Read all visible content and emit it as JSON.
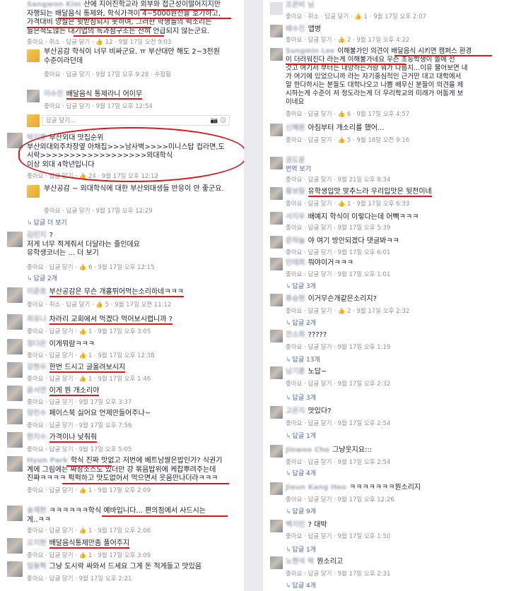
{
  "left": {
    "c1": {
      "l1": "산에 지어진학교라 외부와 접근성이떨어지지만",
      "l2": "자행되는 배달음식 통제와, 학식가격이 4~5000원선을 호가하고,",
      "l3": "가격대비 양질은 뒷받침되지 못하며, 그러한 학생들의 퍽소리는",
      "l4": "들은척도않는 대기업의 독과점구조는 전혀 언급되지 않는군요.",
      "meta": "좋아요 · 취소 · 답글 달기 · 👍 12 · 9월 17일 오전 9:03"
    },
    "c1r1": {
      "text": "부산공감 학식이 너무 비싸군요. ㅠ 부산대만 해도 2~3천원 수준이라던데",
      "meta": "좋아요 · 답글 달기 · 9월 17일 오후 9:28 · 수정됨"
    },
    "c1r2": {
      "text": "배달음식 통제라니 어이무",
      "meta": "좋아요 · 답글 달기 · 9월 17일 오후 12:54"
    },
    "c1input": {
      "placeholder": "답글 달기..."
    },
    "c2": {
      "l0": "부산외대 맛집순위",
      "l1": "부산외대외주차장옆 아채집>>>남사벽>>>>미니스탑 컵라면,도",
      "l2": "시락>>>>>>>>>>>>>>>>>>외대학식",
      "l3": "이상 외대 4학년입니다",
      "meta": "좋아요 · 답글 달기 · 👍 24 · 9월 17일 오후 12:12"
    },
    "c2r1": {
      "text": "부산공감 ~ 외대학식에 대한 부산외대생들 반응이 안 좋군요.",
      "meta": "좋아요 · 답글 달기 · 9월 17일 오후 12:29"
    },
    "c2more": "답글 더 보기",
    "c3": {
      "l1": "?",
      "l2": "저게 너무 적게줘서 더달라는 줄인데요",
      "l3": "유학생코너는 ... 더 보기",
      "meta": "좋아요 · 답글 달기 · 👍 6 · 9월 17일 오후 12:15"
    },
    "c3replies": "답글 2개",
    "items": [
      {
        "text": "부산공감은 무슨 개홀뛰어먹는소리하네ㅋㅋㅋ",
        "meta": "좋아요 · 취소 · 답글 달기 · 👍 5 · 9월 17일 오전 11:12"
      },
      {
        "text": "차라리 교회에서 먹겠다 먹어보시렵니까 ?",
        "meta": "좋아요 · 답글 달기 · 👍 1 · 9월 17일 오후 3:05"
      },
      {
        "text": "이게뭐람ㅋㅋㅋ",
        "meta": "좋아요 · 답글 달기 · 👍 1 · 9월 17일 오후 12:38"
      },
      {
        "text": "한번 드시고 글올려보시지",
        "meta": "좋아요 · 답글 달기 · 👍 1 · 9월 17일 오후 1:46"
      },
      {
        "text": "이게 뭔 개소리야",
        "meta": "좋아요 · 답글 달기 · 9월 17일 오후 3:37"
      },
      {
        "text": "페이스북 싫어요 언제만들어주나~",
        "meta": "좋아요 · 답글 달기 · 9월 17일 오후 7:56"
      },
      {
        "text": "가격이나 낮춰줘",
        "meta": "좋아요 · 답글 달기 · 9월 17일 오후 5:05"
      }
    ],
    "c4": {
      "l1": "학식 진짜 맛없고 저번에 베트남쌀은밥인가? 식권기",
      "l2": "계에 그림에는 짜장소스도 있더만 걍 볶음밥위에 케찹뿌려주는데",
      "l3": "진짜ㅋㅋㅋㅋ 퍽퍽하고 맛도없어서 먹으면서 웃음만나더라ㅋㅋㅋ",
      "meta": "좋아요 · 답글 달기 · 👍 1 · 9월 17일 오후 2:09"
    },
    "c5": {
      "l1": "ㅋㅋㅋㅋㅋㅋ학식 예바입니다... 편의점에서 사드시는",
      "l2": "게..ㅋㅋ",
      "meta": "좋아요 · 답글 달기 · 👍 1 · 9월 17일 오후 2:06"
    },
    "c6": {
      "text": "배달음식통제만좀 풀어주지",
      "meta": "좋아요 · 답글 달기 · 👍 1 · 9월 17일 오후 3:09"
    },
    "c7": {
      "text": "그냥 도시락 싸와서 드세요 그게 돈 적게들고 맛있음",
      "meta": "좋아요 · 답글 달기 · 9월 17일 오후 2:21"
    }
  },
  "right": {
    "r1meta": "좋아요 · 취소 · 답글 달기 · 👍 1 · 9월 17일 오후 2:07",
    "r2": {
      "text": "앱병",
      "meta": "좋아요 · 답글 달기 · 👍 2 · 9월 17일 오후 4:22"
    },
    "r3": {
      "l1": "이해불가인 의견이 배달음식 시키면 캠퍼스 환경",
      "l2": "이 더러워진다 라는게 이해불가네요 무슨 초등학생이 쓸에 선",
      "l3": "것고 여기서 부터는 내망하는거랑 뭐가 다름지...이유 물어보면 내",
      "l4": "가 여기에 있었으니까 라는 자기중심적인 근거만 대고 대학에서",
      "l5": "알 한다하시는 분들도 대학나오고 나쁨 배우신 분들이 의견을 제",
      "l6": "시하는게 수준이 저 정도라는게 더 우리학교의 미래가 어둡게 보",
      "l7": "이네요",
      "meta": "좋아요 · 답글 달기 · 👍 6 · 9월 17일 오후 4:57"
    },
    "r4": {
      "text": "아침부터 개소리를 했어...",
      "meta": "좋아요 · 답글 달기 · 👍 5 · 9월 18일 오전 9:16"
    },
    "r5": {
      "text": "번역 보기",
      "meta": "좋아요 · 답글 달기 · 9월 21일 오후 8:34"
    },
    "r6": {
      "text": "유학생입맛 맞추느라 우리입맛은 뒷전이네",
      "meta": "좋아요 · 답글 달기 · 👍 1 · 9월 17일 오후 6:33"
    },
    "r7": {
      "text": "배예지 학식이 이렇다는데 어빽ㅋㅋㅋ",
      "meta": "좋아요 · 답글 달기 · 9월 17일 오후 5:39"
    },
    "r8": {
      "text": "야 여기 방안되겠다 댓글봐ㅋㅋ",
      "meta": "좋아요 · 답글 달기 · 9월 17일 오후 6:01"
    },
    "r9": {
      "text": "뭐야이거ㅋㅋㅋ",
      "meta": "좋아요 · 답글 달기 · 9월 17일 오후 1:01"
    },
    "r9replies": "답글 3개",
    "r10": {
      "text": "이거무슨개같은소리지?",
      "meta": "좋아요 · 답글 달기 · 👍 2 · 9월 17일 오후 2:32"
    },
    "r10replies": "답글 2개",
    "r11": {
      "text": "?????",
      "meta": "좋아요 · 답글 달기 · 9월 17일 오후 1:19"
    },
    "r11replies": "답글 13개",
    "r12": {
      "text": "노답~",
      "meta": "좋아요 · 답글 달기 · 9월 17일 오후 2:32"
    },
    "r12replies": "답글 3개",
    "r13": {
      "text": "맛있다?",
      "meta": "좋아요 · 답글 달기 · 9월 17일 오후 2:54"
    },
    "r13replies": "답글 1개",
    "r14": {
      "text": "그냥웃지요:::",
      "meta": "좋아요 · 답글 달기 · 9월 17일 오후 2:54"
    },
    "r14replies": "답글 4개",
    "r15": {
      "text": "ㅋㅋㅋㅋㅋㅋㅋ뭔소리지",
      "meta": "좋아요 · 답글 달기 · 9월 17일 오후 12:26"
    },
    "r15replies": "답글 9개",
    "r16": {
      "text": "? 대박",
      "meta": "좋아요 · 답글 달기 · 9월 17일 오후 1:50"
    },
    "r16replies": "답글 1개",
    "r17": {
      "text": "뭔소리고",
      "meta": "좋아요 · 답글 달기 · 9월 17일 오후 2:31"
    },
    "r17replies": "답글 4개"
  },
  "colors": {
    "underline": "#e0141b",
    "link": "#4b67a1",
    "meta": "#90949c"
  }
}
